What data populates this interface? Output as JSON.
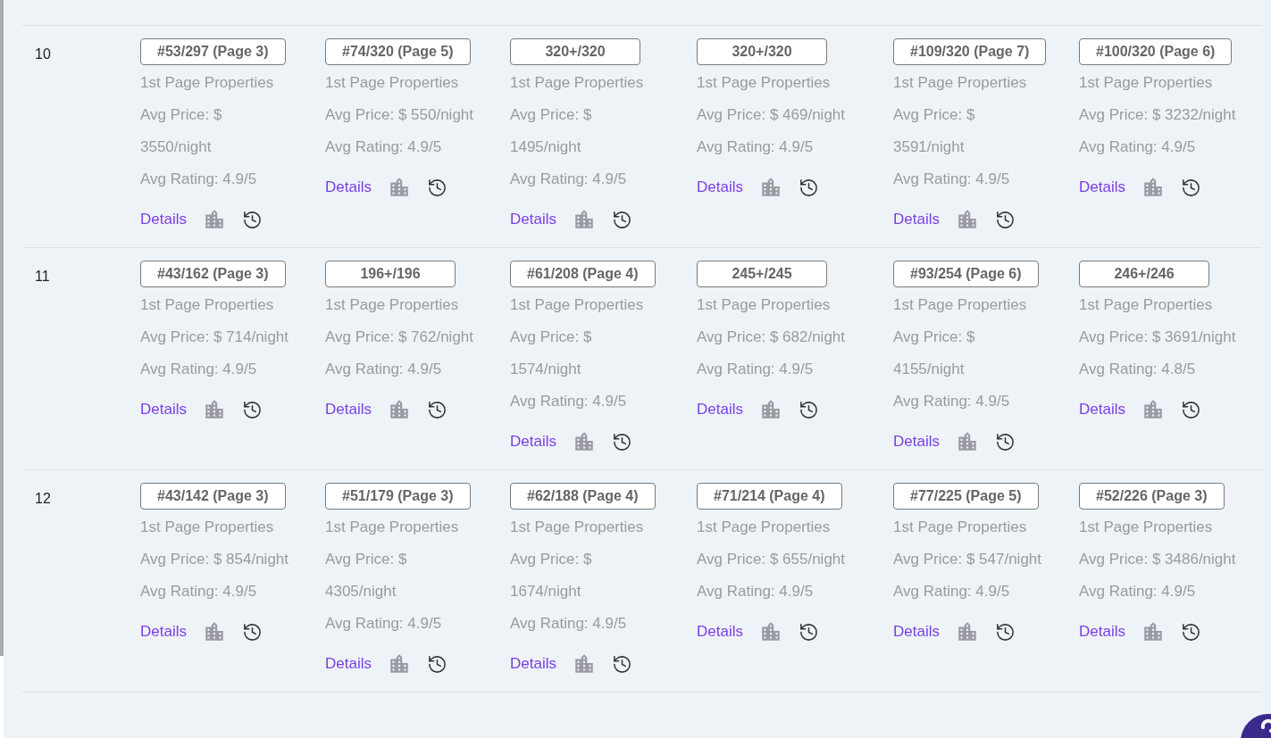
{
  "rows": [
    {
      "number": "10",
      "cells": [
        {
          "rank": "#53/297 (Page 3)",
          "label": "1st Page Properties",
          "price": "Avg Price: $ 3550/night",
          "rating": "Avg Rating: 4.9/5",
          "link": "Details"
        },
        {
          "rank": "#74/320 (Page 5)",
          "label": "1st Page Properties",
          "price": "Avg Price: $ 550/night",
          "rating": "Avg Rating: 4.9/5",
          "link": "Details"
        },
        {
          "rank": "320+/320",
          "label": "1st Page Properties",
          "price": "Avg Price: $ 1495/night",
          "rating": "Avg Rating: 4.9/5",
          "link": "Details"
        },
        {
          "rank": "320+/320",
          "label": "1st Page Properties",
          "price": "Avg Price: $ 469/night",
          "rating": "Avg Rating: 4.9/5",
          "link": "Details"
        },
        {
          "rank": "#109/320 (Page 7)",
          "label": "1st Page Properties",
          "price": "Avg Price: $ 3591/night",
          "rating": "Avg Rating: 4.9/5",
          "link": "Details"
        },
        {
          "rank": "#100/320 (Page 6)",
          "label": "1st Page Properties",
          "price": "Avg Price: $ 3232/night",
          "rating": "Avg Rating: 4.9/5",
          "link": "Details"
        }
      ]
    },
    {
      "number": "11",
      "cells": [
        {
          "rank": "#43/162 (Page 3)",
          "label": "1st Page Properties",
          "price": "Avg Price: $ 714/night",
          "rating": "Avg Rating: 4.9/5",
          "link": "Details"
        },
        {
          "rank": "196+/196",
          "label": "1st Page Properties",
          "price": "Avg Price: $ 762/night",
          "rating": "Avg Rating: 4.9/5",
          "link": "Details"
        },
        {
          "rank": "#61/208 (Page 4)",
          "label": "1st Page Properties",
          "price": "Avg Price: $ 1574/night",
          "rating": "Avg Rating: 4.9/5",
          "link": "Details"
        },
        {
          "rank": "245+/245",
          "label": "1st Page Properties",
          "price": "Avg Price: $ 682/night",
          "rating": "Avg Rating: 4.9/5",
          "link": "Details"
        },
        {
          "rank": "#93/254 (Page 6)",
          "label": "1st Page Properties",
          "price": "Avg Price: $ 4155/night",
          "rating": "Avg Rating: 4.9/5",
          "link": "Details"
        },
        {
          "rank": "246+/246",
          "label": "1st Page Properties",
          "price": "Avg Price: $ 3691/night",
          "rating": "Avg Rating: 4.8/5",
          "link": "Details"
        }
      ]
    },
    {
      "number": "12",
      "cells": [
        {
          "rank": "#43/142 (Page 3)",
          "label": "1st Page Properties",
          "price": "Avg Price: $ 854/night",
          "rating": "Avg Rating: 4.9/5",
          "link": "Details"
        },
        {
          "rank": "#51/179 (Page 3)",
          "label": "1st Page Properties",
          "price": "Avg Price: $ 4305/night",
          "rating": "Avg Rating: 4.9/5",
          "link": "Details"
        },
        {
          "rank": "#62/188 (Page 4)",
          "label": "1st Page Properties",
          "price": "Avg Price: $ 1674/night",
          "rating": "Avg Rating: 4.9/5",
          "link": "Details"
        },
        {
          "rank": "#71/214 (Page 4)",
          "label": "1st Page Properties",
          "price": "Avg Price: $ 655/night",
          "rating": "Avg Rating: 4.9/5",
          "link": "Details"
        },
        {
          "rank": "#77/225 (Page 5)",
          "label": "1st Page Properties",
          "price": "Avg Price: $ 547/night",
          "rating": "Avg Rating: 4.9/5",
          "link": "Details"
        },
        {
          "rank": "#52/226 (Page 3)",
          "label": "1st Page Properties",
          "price": "Avg Price: $ 3486/night",
          "rating": "Avg Rating: 4.9/5",
          "link": "Details"
        }
      ]
    }
  ]
}
